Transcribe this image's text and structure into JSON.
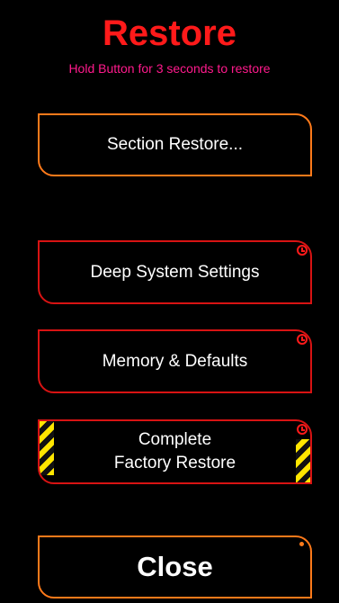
{
  "header": {
    "title": "Restore",
    "subtitle": "Hold Button for 3 seconds to restore"
  },
  "buttons": {
    "section_restore": "Section Restore...",
    "deep_system": "Deep System Settings",
    "memory_defaults": "Memory & Defaults",
    "factory_restore": "Complete\nFactory Restore",
    "close": "Close"
  },
  "icons": {
    "hold_timer": "clock-icon",
    "indicator": "dot-icon",
    "warning": "hazard-stripe"
  },
  "colors": {
    "background": "#000000",
    "title": "#ff1a1a",
    "subtitle": "#ff1a8c",
    "orange_border": "#ff7a1a",
    "red_border": "#d81313",
    "hazard_yellow": "#ffe600"
  }
}
